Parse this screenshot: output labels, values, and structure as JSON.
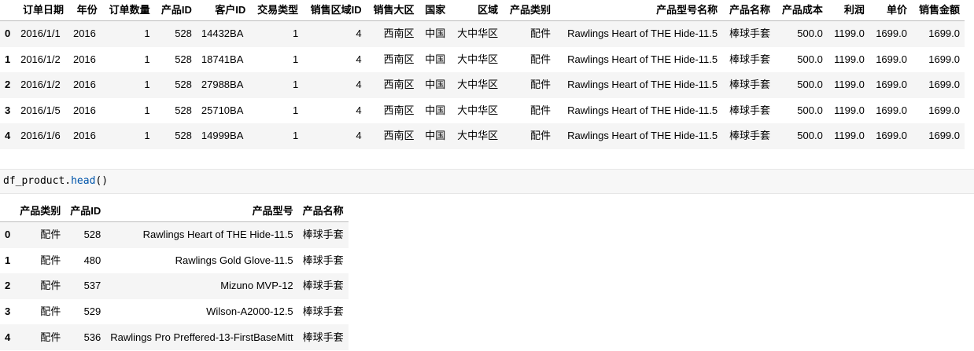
{
  "table1": {
    "columns": [
      "",
      "订单日期",
      "年份",
      "订单数量",
      "产品ID",
      "客户ID",
      "交易类型",
      "销售区域ID",
      "销售大区",
      "国家",
      "区域",
      "产品类别",
      "产品型号名称",
      "产品名称",
      "产品成本",
      "利润",
      "单价",
      "销售金额"
    ],
    "rows": [
      [
        "0",
        "2016/1/1",
        "2016",
        "1",
        "528",
        "14432BA",
        "1",
        "4",
        "西南区",
        "中国",
        "大中华区",
        "配件",
        "Rawlings Heart of THE Hide-11.5",
        "棒球手套",
        "500.0",
        "1199.0",
        "1699.0",
        "1699.0"
      ],
      [
        "1",
        "2016/1/2",
        "2016",
        "1",
        "528",
        "18741BA",
        "1",
        "4",
        "西南区",
        "中国",
        "大中华区",
        "配件",
        "Rawlings Heart of THE Hide-11.5",
        "棒球手套",
        "500.0",
        "1199.0",
        "1699.0",
        "1699.0"
      ],
      [
        "2",
        "2016/1/2",
        "2016",
        "1",
        "528",
        "27988BA",
        "1",
        "4",
        "西南区",
        "中国",
        "大中华区",
        "配件",
        "Rawlings Heart of THE Hide-11.5",
        "棒球手套",
        "500.0",
        "1199.0",
        "1699.0",
        "1699.0"
      ],
      [
        "3",
        "2016/1/5",
        "2016",
        "1",
        "528",
        "25710BA",
        "1",
        "4",
        "西南区",
        "中国",
        "大中华区",
        "配件",
        "Rawlings Heart of THE Hide-11.5",
        "棒球手套",
        "500.0",
        "1199.0",
        "1699.0",
        "1699.0"
      ],
      [
        "4",
        "2016/1/6",
        "2016",
        "1",
        "528",
        "14999BA",
        "1",
        "4",
        "西南区",
        "中国",
        "大中华区",
        "配件",
        "Rawlings Heart of THE Hide-11.5",
        "棒球手套",
        "500.0",
        "1199.0",
        "1699.0",
        "1699.0"
      ]
    ]
  },
  "code_cell": {
    "variable": "df_product",
    "dot": ".",
    "method": "head",
    "parens": "()"
  },
  "table2": {
    "columns": [
      "",
      "产品类别",
      "产品ID",
      "产品型号",
      "产品名称"
    ],
    "rows": [
      [
        "0",
        "配件",
        "528",
        "Rawlings Heart of THE Hide-11.5",
        "棒球手套"
      ],
      [
        "1",
        "配件",
        "480",
        "Rawlings Gold Glove-11.5",
        "棒球手套"
      ],
      [
        "2",
        "配件",
        "537",
        "Mizuno MVP-12",
        "棒球手套"
      ],
      [
        "3",
        "配件",
        "529",
        "Wilson-A2000-12.5",
        "棒球手套"
      ],
      [
        "4",
        "配件",
        "536",
        "Rawlings Pro Preffered-13-FirstBaseMitt",
        "棒球手套"
      ]
    ]
  }
}
